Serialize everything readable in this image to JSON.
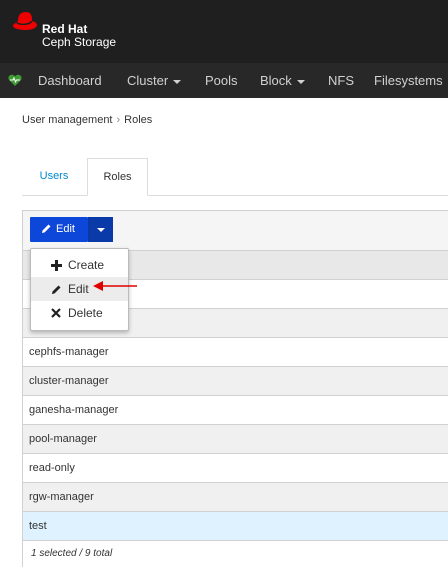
{
  "header": {
    "brand_line1": "Red Hat",
    "brand_line2": "Ceph Storage",
    "logo_icon": "redhat-logo-icon"
  },
  "nav": {
    "items": [
      {
        "label": "Dashboard",
        "icon": "heartbeat-icon"
      },
      {
        "label": "Cluster",
        "dropdown": true
      },
      {
        "label": "Pools"
      },
      {
        "label": "Block",
        "dropdown": true
      },
      {
        "label": "NFS"
      },
      {
        "label": "Filesystems"
      }
    ]
  },
  "breadcrumb": {
    "parent": "User management",
    "separator": "›",
    "current": "Roles"
  },
  "tabs": [
    {
      "label": "Users",
      "active": false
    },
    {
      "label": "Roles",
      "active": true
    }
  ],
  "toolbar": {
    "edit_label": "Edit"
  },
  "menu": {
    "items": [
      {
        "label": "Create",
        "icon": "plus-icon"
      },
      {
        "label": "Edit",
        "icon": "pencil-icon"
      },
      {
        "label": "Delete",
        "icon": "times-icon"
      }
    ]
  },
  "table": {
    "rows": [
      {
        "name": ""
      },
      {
        "name": ""
      },
      {
        "name": ""
      },
      {
        "name": "cephfs-manager"
      },
      {
        "name": "cluster-manager"
      },
      {
        "name": "ganesha-manager"
      },
      {
        "name": "pool-manager"
      },
      {
        "name": "read-only"
      },
      {
        "name": "rgw-manager"
      },
      {
        "name": "test",
        "selected": true
      }
    ],
    "footer": "1 selected / 9 total"
  },
  "colors": {
    "masthead": "#1f1f1f",
    "navbar": "#282828",
    "primary_button": "#0d47d9",
    "link": "#0088ce",
    "selected_row": "#def3ff",
    "annotation_arrow": "#e00000"
  }
}
